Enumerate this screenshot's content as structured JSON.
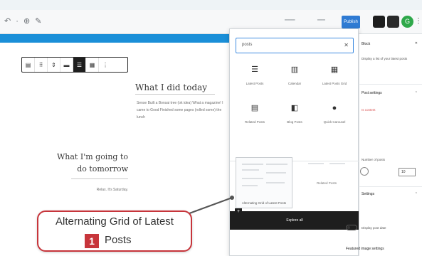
{
  "toolbar": {
    "publish_label": "Publish",
    "avatar_letter": "G"
  },
  "editor": {
    "heading_today": "What I did today",
    "paragraph_today": "Sense Built a Bonsai tree (ok idea) What a magazine! I came to Good Finished some pages (rolled some) the lunch",
    "heading_tomorrow_line1": "What I'm going to",
    "heading_tomorrow_line2": "do tomorrow",
    "paragraph_relax": "Relax. It's Saturday."
  },
  "inserter": {
    "search_value": "posts",
    "blocks": [
      {
        "icon": "list-icon",
        "label": "Latest Posts"
      },
      {
        "icon": "archive-icon",
        "label": "Calendar"
      },
      {
        "icon": "grid-icon",
        "label": "Latest Posts Grid"
      },
      {
        "icon": "pin-icon",
        "label": "Related Posts"
      },
      {
        "icon": "blog-icon",
        "label": "Blog Posts"
      },
      {
        "icon": "quote-icon",
        "label": "Quick Carousel"
      }
    ],
    "pattern1_label": "Alternating Grid of Latest Posts",
    "pattern2_label": "Related Posts",
    "browse_label": "Explore all"
  },
  "sidebar": {
    "heading1": "Block",
    "text1": "Display a list of your latest posts",
    "heading2": "Post settings",
    "red_text": "Is content",
    "text2": "Number of posts",
    "number_value": "10",
    "heading3": "Settings",
    "text3": "Display post date",
    "heading4": "Featured image settings"
  },
  "callout": {
    "line1": "Alternating Grid of Latest",
    "badge": "1",
    "line2": "Posts"
  },
  "colors": {
    "accent": "#1a8fd8",
    "callout_red": "#c7353b",
    "publish_blue": "#2f7bd3"
  }
}
